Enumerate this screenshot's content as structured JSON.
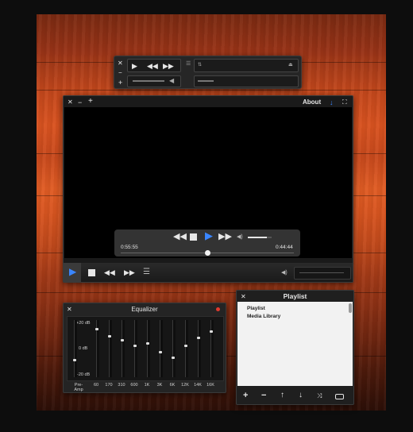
{
  "mini_player": {
    "time_left": "",
    "time_right": ""
  },
  "main_player": {
    "header": {
      "about_label": "About"
    },
    "osd": {
      "elapsed": "0:55:55",
      "remaining": "0:44:44",
      "progress_fraction": 0.5,
      "volume_fraction": 0.8
    }
  },
  "equalizer": {
    "title": "Equalizer",
    "db_labels": [
      "+20 dB",
      "0 dB",
      "-20 dB"
    ],
    "bands": [
      {
        "label": "Pre-Amp",
        "level": 0.3
      },
      {
        "label": "60",
        "level": 0.85
      },
      {
        "label": "170",
        "level": 0.72
      },
      {
        "label": "310",
        "level": 0.65
      },
      {
        "label": "600",
        "level": 0.55
      },
      {
        "label": "1K",
        "level": 0.6
      },
      {
        "label": "3K",
        "level": 0.45
      },
      {
        "label": "6K",
        "level": 0.35
      },
      {
        "label": "12K",
        "level": 0.55
      },
      {
        "label": "14K",
        "level": 0.7
      },
      {
        "label": "16K",
        "level": 0.8
      }
    ]
  },
  "playlist": {
    "title": "Playlist",
    "items": [
      "Playlist",
      "Media Library"
    ]
  },
  "colors": {
    "accent": "#3a86ff",
    "close_dot": "#e03a2e"
  }
}
